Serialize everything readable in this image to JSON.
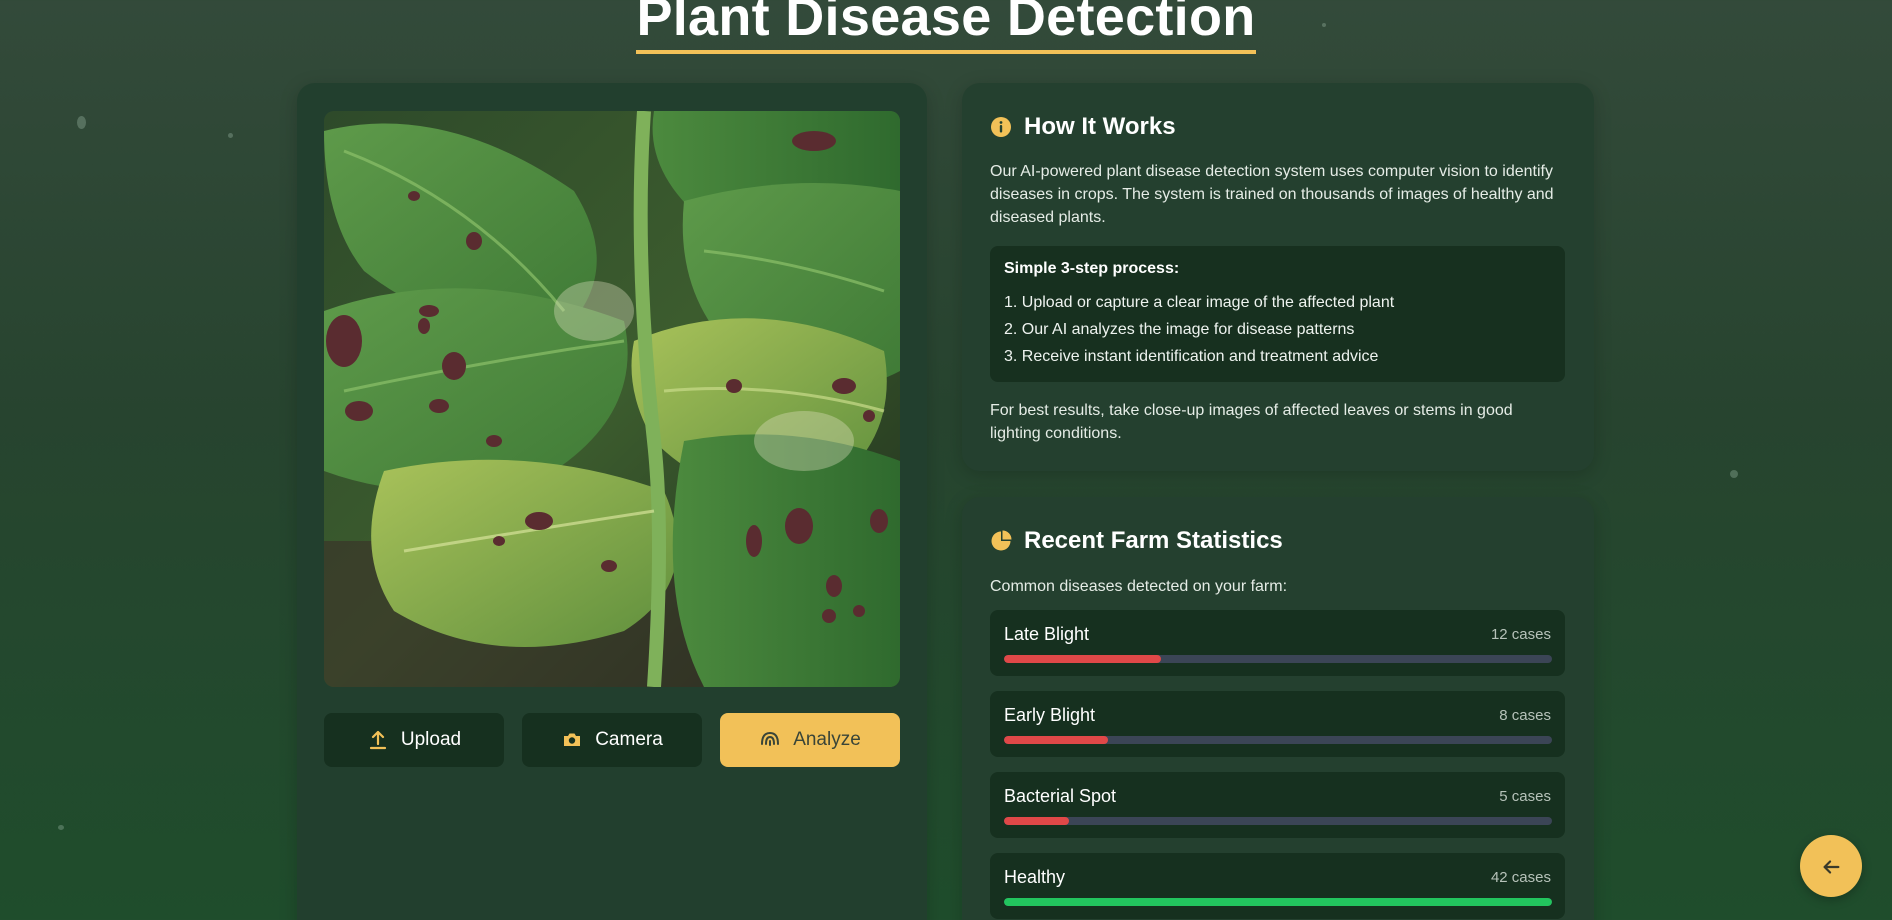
{
  "page": {
    "title": "Plant Disease Detection"
  },
  "colors": {
    "accent": "#f2c158",
    "card": "#223f2e",
    "disease_bar": "#e04848",
    "healthy_bar": "#22c55e",
    "track": "#3b4556"
  },
  "actions": {
    "upload": {
      "label": "Upload",
      "icon": "upload-icon"
    },
    "camera": {
      "label": "Camera",
      "icon": "camera-icon"
    },
    "analyze": {
      "label": "Analyze",
      "icon": "scan-icon"
    }
  },
  "how_it_works": {
    "heading": "How It Works",
    "icon": "info-icon",
    "intro": "Our AI-powered plant disease detection system uses computer vision to identify diseases in crops. The system is trained on thousands of images of healthy and diseased plants.",
    "steps_title": "Simple 3-step process:",
    "steps": [
      "1. Upload or capture a clear image of the affected plant",
      "2. Our AI analyzes the image for disease patterns",
      "3. Receive instant identification and treatment advice"
    ],
    "tip": "For best results, take close-up images of affected leaves or stems in good lighting conditions."
  },
  "stats": {
    "heading": "Recent Farm Statistics",
    "icon": "pie-chart-icon",
    "subtitle": "Common diseases detected on your farm:",
    "items": [
      {
        "name": "Late Blight",
        "count": "12 cases",
        "fill_pct": 28.6,
        "status": "disease"
      },
      {
        "name": "Early Blight",
        "count": "8 cases",
        "fill_pct": 19.0,
        "status": "disease"
      },
      {
        "name": "Bacterial Spot",
        "count": "5 cases",
        "fill_pct": 11.9,
        "status": "disease"
      },
      {
        "name": "Healthy",
        "count": "42 cases",
        "fill_pct": 100,
        "status": "healthy"
      }
    ]
  },
  "back_button": {
    "icon": "arrow-left-icon"
  }
}
